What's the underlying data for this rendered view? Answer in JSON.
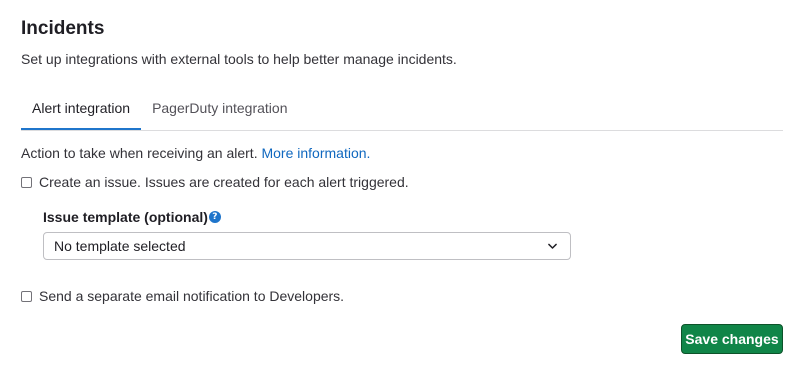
{
  "page": {
    "title": "Incidents",
    "subtitle": "Set up integrations with external tools to help better manage incidents."
  },
  "tabs": [
    {
      "label": "Alert integration",
      "active": true
    },
    {
      "label": "PagerDuty integration",
      "active": false
    }
  ],
  "alert": {
    "help_text": "Action to take when receiving an alert.",
    "help_link": "More information.",
    "create_issue_label": "Create an issue. Issues are created for each alert triggered.",
    "create_issue_checked": false,
    "template_label": "Issue template (optional)",
    "template_value": "No template selected",
    "email_label": "Send a separate email notification to Developers.",
    "email_checked": false
  },
  "actions": {
    "save_label": "Save changes"
  },
  "icons": {
    "help": "question-circle-icon",
    "dropdown": "chevron-down-icon"
  },
  "colors": {
    "accent_blue": "#1f75cb",
    "link_blue": "#1068bf",
    "save_green": "#108548"
  }
}
